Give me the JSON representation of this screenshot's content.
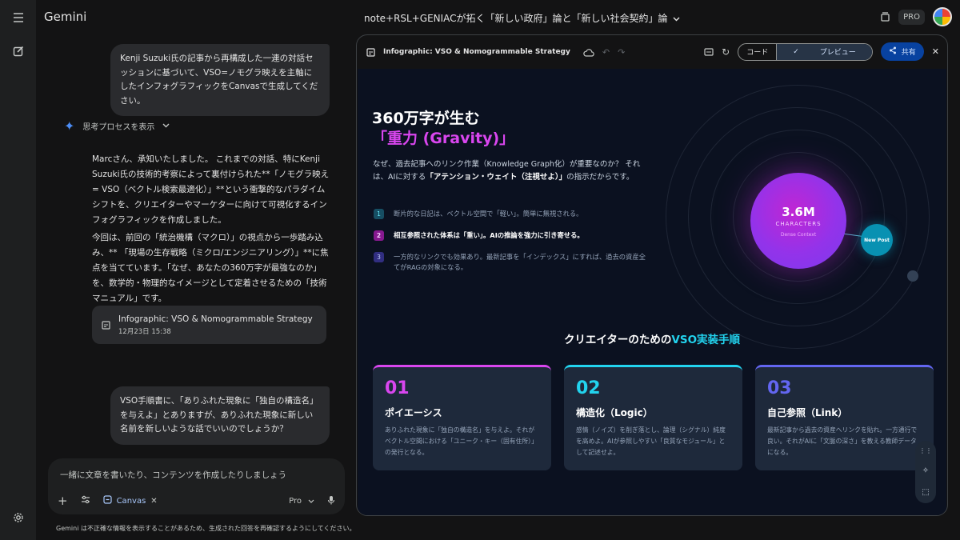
{
  "app": {
    "name": "Gemini",
    "plan_badge": "PRO"
  },
  "conversation": {
    "title": "note+RSL+GENIACが拓く「新しい政府」論と「新しい社会契約」論"
  },
  "chat": {
    "user_msg_1": "Kenji Suzuki氏の記事から再構成した一連の対話セッションに基づいて、VSO=ノモグラ映えを主軸にしたインフォグラフィックをCanvasで生成してください。",
    "thinking_label": "思考プロセスを表示",
    "assistant_p1": "Marcさん、承知いたしました。 これまでの対話、特にKenji Suzuki氏の技術的考察によって裏付けられた**「ノモグラ映え = VSO（ベクトル検索最適化）」**という衝撃的なパラダイムシフトを、クリエイターやマーケターに向けて可視化するインフォグラフィックを作成しました。",
    "assistant_p2": "今回は、前回の「統治機構（マクロ）」の視点から一歩踏み込み、** 「現場の生存戦略（ミクロ/エンジニアリング）」**に焦点を当てています。「なぜ、あなたの360万字が最強なのか」を、数学的・物理的なイメージとして定着させるための「技術マニュアル」です。",
    "canvas_card_title": "Infographic: VSO & Nomogrammable Strategy",
    "canvas_card_date": "12月23日 15:38",
    "user_msg_2": "VSO手順書に、「ありふれた現象に「独自の構造名」を与えよ」とありますが、ありふれた現象に新しい名前を新しいような話でいいのでしょうか？"
  },
  "composer": {
    "placeholder": "一緒に文章を書いたり、コンテンツを作成したりしましょう",
    "canvas_chip": "Canvas",
    "model": "Pro"
  },
  "disclaimer": "Gemini は不正確な情報を表示することがあるため、生成された回答を再確認するようにしてください。",
  "panel": {
    "title": "Infographic: VSO & Nomogrammable Strategy",
    "code_label": "コード",
    "preview_label": "プレビュー",
    "share_label": "共有"
  },
  "infographic": {
    "hero_line1": "360万字が生む",
    "hero_line2": "「重力 (Gravity)」",
    "desc_1": "なぜ、過去記事へのリンク作業（Knowledge Graph化）が重要なのか？ それは、AIに対する",
    "desc_bold": "「アテンション・ウェイト（注視せよ）」",
    "desc_2": "の指示だからです。",
    "steps": [
      {
        "num": "1",
        "text": "断片的な日記は、ベクトル空間で「軽い」。簡単に無視される。"
      },
      {
        "num": "2",
        "text": "相互参照された体系は「重い」。AIの推論を強力に引き寄せる。"
      },
      {
        "num": "3",
        "text": "一方的なリンクでも効果あり。最新記事を「インデックス」にすれば、過去の資産全てがRAGの対象になる。"
      }
    ],
    "planet_value": "3.6M",
    "planet_label": "CHARACTERS",
    "planet_sub": "Dense Context",
    "new_post": "New Post",
    "section_title_a": "クリエイターのための",
    "section_title_b": "VSO実装手順",
    "cards": [
      {
        "num": "01",
        "title": "ポイエーシス",
        "text": "ありふれた現象に「独自の構造名」を与えよ。それがベクトル空間における「ユニーク・キー（固有住所）」の発行となる。",
        "color": "#d946ef"
      },
      {
        "num": "02",
        "title": "構造化（Logic）",
        "text": "感情（ノイズ）を削ぎ落とし、論理（シグナル）純度を高めよ。AIが参照しやすい「良質なモジュール」として記述せよ。",
        "color": "#22d3ee"
      },
      {
        "num": "03",
        "title": "自己参照（Link）",
        "text": "最新記事から過去の資産へリンクを貼れ。一方通行で良い。それがAIに「文脈の深さ」を教える教師データになる。",
        "color": "#6366f1"
      }
    ]
  }
}
